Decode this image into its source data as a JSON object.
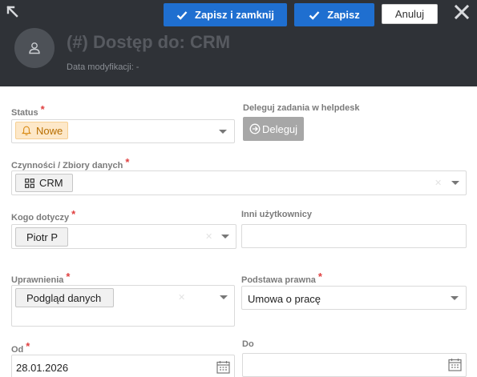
{
  "header": {
    "title": "(#) Dostęp do: CRM",
    "subtitle": "Data modyfikacji: -",
    "save_close_label": "Zapisz i zamknij",
    "save_label": "Zapisz",
    "cancel_label": "Anuluj"
  },
  "form": {
    "status": {
      "label": "Status",
      "required": "*",
      "value": "Nowe"
    },
    "delegate": {
      "label": "Deleguj zadania w helpdesk",
      "button": "Deleguj"
    },
    "activities": {
      "label": "Czynności / Zbiory danych",
      "required": "*",
      "value": "CRM"
    },
    "concerns": {
      "label": "Kogo dotyczy",
      "required": "*",
      "value": "Piotr P"
    },
    "other_users": {
      "label": "Inni użytkownicy",
      "value": ""
    },
    "permissions": {
      "label": "Uprawnienia",
      "required": "*",
      "value": "Podgląd danych"
    },
    "legal_basis": {
      "label": "Podstawa prawna",
      "required": "*",
      "value": "Umowa o pracę"
    },
    "date_from": {
      "label": "Od",
      "required": "*",
      "value": "28.01.2026"
    },
    "date_to": {
      "label": "Do",
      "value": ""
    }
  },
  "colors": {
    "header_bg": "#2f3237",
    "primary": "#1f6fd0",
    "required": "#e04040",
    "status_badge_bg": "#fde8c9",
    "status_badge_text": "#b86e00",
    "delegate_bg": "#a7a7a7"
  },
  "icons": {
    "expand": "expand-arrow-icon",
    "close": "close-icon",
    "check": "check-icon",
    "avatar": "user-icon",
    "bell": "bell-icon",
    "delegate": "arrow-circle-right-icon",
    "grid": "grid-icon",
    "calendar": "calendar-icon",
    "caret": "chevron-down-icon"
  }
}
